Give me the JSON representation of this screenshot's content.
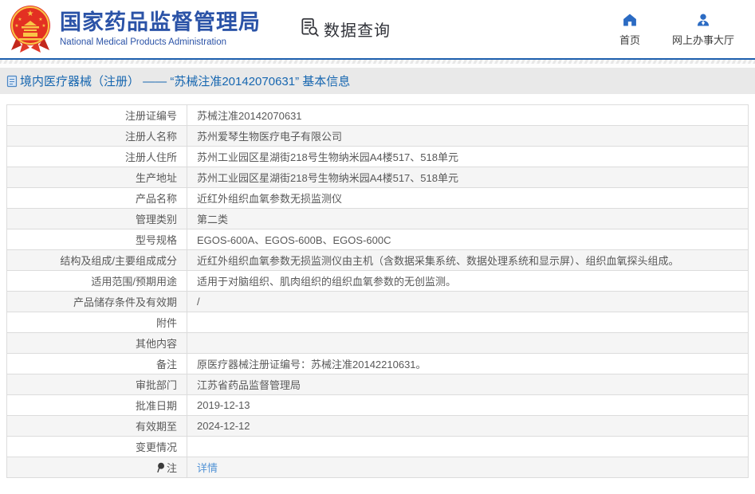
{
  "brand": {
    "agency_cn": "国家药品监督管理局",
    "agency_en": "National Medical Products Administration",
    "section": "数据查询"
  },
  "nav": {
    "home": "首页",
    "service_hall": "网上办事大厅"
  },
  "breadcrumb": {
    "title": "境内医疗器械（注册） —— “苏械注准20142070631” 基本信息"
  },
  "table": {
    "rows": [
      {
        "label": "注册证编号",
        "value": "苏械注准20142070631"
      },
      {
        "label": "注册人名称",
        "value": "苏州爱琴生物医疗电子有限公司"
      },
      {
        "label": "注册人住所",
        "value": "苏州工业园区星湖街218号生物纳米园A4楼517、518单元"
      },
      {
        "label": "生产地址",
        "value": "苏州工业园区星湖街218号生物纳米园A4楼517、518单元"
      },
      {
        "label": "产品名称",
        "value": "近红外组织血氧参数无损监测仪"
      },
      {
        "label": "管理类别",
        "value": "第二类"
      },
      {
        "label": "型号规格",
        "value": "EGOS-600A、EGOS-600B、EGOS-600C"
      },
      {
        "label": "结构及组成/主要组成成分",
        "value": "近红外组织血氧参数无损监测仪由主机（含数据采集系统、数据处理系统和显示屏）、组织血氧探头组成。"
      },
      {
        "label": "适用范围/预期用途",
        "value": "适用于对脑组织、肌肉组织的组织血氧参数的无创监测。"
      },
      {
        "label": "产品储存条件及有效期",
        "value": "/"
      },
      {
        "label": "附件",
        "value": ""
      },
      {
        "label": "其他内容",
        "value": ""
      },
      {
        "label": "备注",
        "value": "原医疗器械注册证编号：苏械注准20142210631。"
      },
      {
        "label": "审批部门",
        "value": "江苏省药品监督管理局"
      },
      {
        "label": "批准日期",
        "value": "2019-12-13"
      },
      {
        "label": "有效期至",
        "value": "2024-12-12"
      },
      {
        "label": "变更情况",
        "value": ""
      },
      {
        "label": "注",
        "value": "",
        "icon": "pin-icon",
        "link_label": "详情"
      }
    ]
  },
  "colors": {
    "brand_blue": "#2b53a7",
    "nav_icon_blue": "#2b6bc3",
    "breadcrumb_blue": "#1666b0",
    "divider_blue": "#1d5fae",
    "link_blue": "#5494d6",
    "band_gray": "#e9e9e9",
    "row_alt_gray": "#f5f5f5",
    "border_gray": "#dcdcdc",
    "text_gray": "#595959",
    "emblem_red": "#e33022",
    "emblem_gold": "#f9c546",
    "icon_dark": "#33343a"
  }
}
